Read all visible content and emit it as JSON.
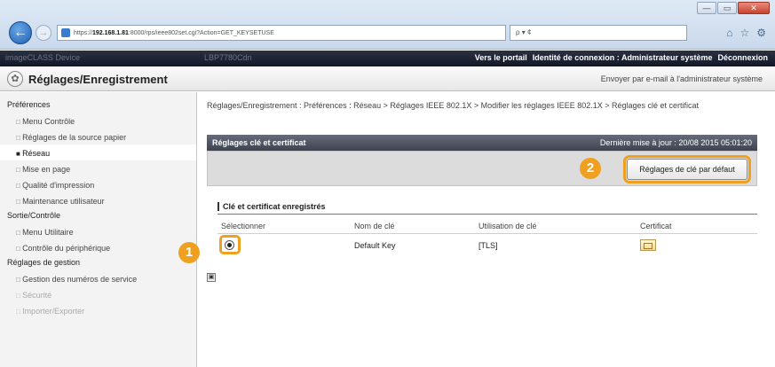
{
  "browser": {
    "url_prefix": "https://",
    "url_host": "192.168.1.81",
    "url_path": ":8000/rps/ieee802set.cgi?Action=GET_KEYSETUSE",
    "search_text": "ρ ▾ ¢",
    "window_buttons": [
      "—",
      "▭",
      "✕"
    ],
    "icons": [
      "home-icon",
      "star-icon",
      "gear-icon"
    ]
  },
  "topbar": {
    "device_name": "imageCLASS Device",
    "device_model": "LBP7780Cdn",
    "links": [
      "Vers le portail",
      "Identité de connexion : Administrateur système",
      "Déconnexion"
    ]
  },
  "app": {
    "title": "Réglages/Enregistrement",
    "mail_link": "Envoyer par e-mail à l'administrateur système"
  },
  "sidebar": {
    "sections": [
      {
        "title": "Préférences",
        "items": [
          {
            "label": "Menu Contrôle",
            "active": false
          },
          {
            "label": "Réglages de la source papier",
            "active": false
          },
          {
            "label": "Réseau",
            "active": true
          },
          {
            "label": "Mise en page",
            "active": false
          },
          {
            "label": "Qualité d'impression",
            "active": false
          },
          {
            "label": "Maintenance utilisateur",
            "active": false
          }
        ]
      },
      {
        "title": "Sortie/Contrôle",
        "items": [
          {
            "label": "Menu Utilitaire",
            "active": false
          },
          {
            "label": "Contrôle du périphérique",
            "active": false
          }
        ]
      },
      {
        "title": "Réglages de gestion",
        "items": [
          {
            "label": "Gestion des numéros de service",
            "active": false
          },
          {
            "label": "Sécurité",
            "active": false
          },
          {
            "label": "Importer/Exporter",
            "active": false
          }
        ]
      }
    ]
  },
  "main": {
    "breadcrumb": "Réglages/Enregistrement : Préférences : Réseau > Réglages IEEE 802.1X > Modifier les réglages IEEE 802.1X > Réglages clé et certificat",
    "panel_title": "Réglages clé et certificat",
    "last_update": "Dernière mise à jour : 20/08 2015 05:01:20",
    "default_button": "Réglages de clé par défaut",
    "callout_1": "1",
    "callout_2": "2",
    "section_title": "Clé et certificat enregistrés",
    "table": {
      "headers": [
        "Sélectionner",
        "Nom de clé",
        "Utilisation de clé",
        "Certificat"
      ],
      "rows": [
        {
          "key_name": "Default Key",
          "usage": "[TLS]",
          "selected": true
        }
      ]
    },
    "page_nav": "▣"
  },
  "colors": {
    "callout": "#f0a020",
    "topbar": "#1c2232",
    "panel_head": "#4d5360"
  }
}
